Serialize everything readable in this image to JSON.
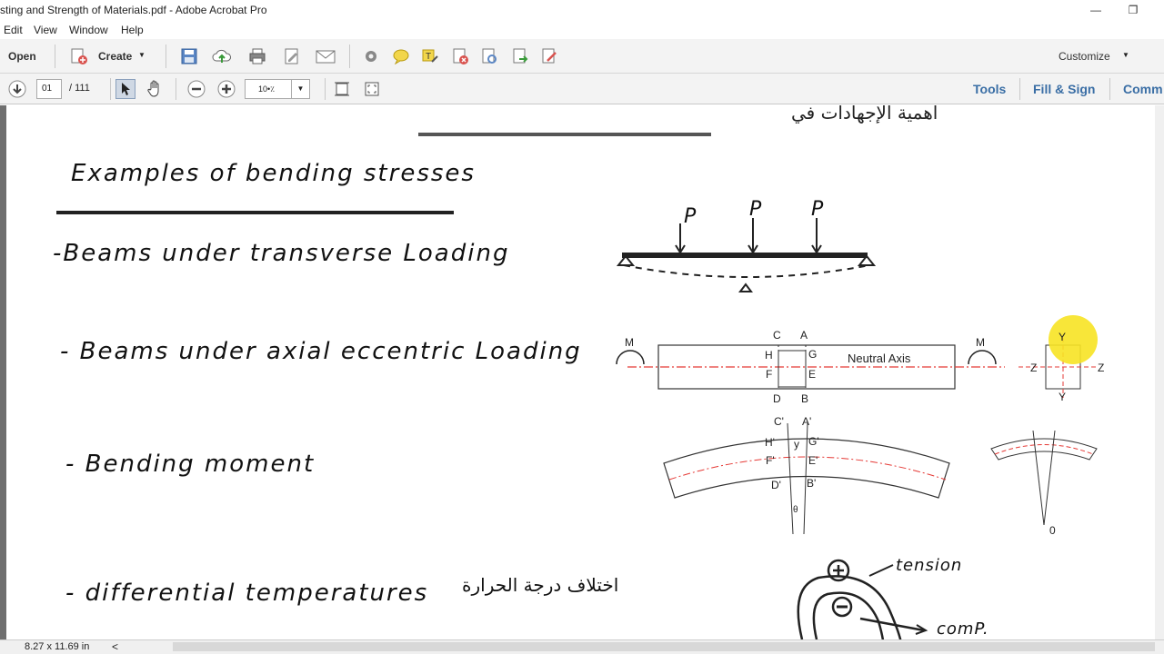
{
  "window": {
    "title": "sting and Strength of Materials.pdf - Adobe Acrobat Pro",
    "minimize": "—",
    "restore": "❐"
  },
  "menu": [
    "Edit",
    "View",
    "Window",
    "Help"
  ],
  "toolbar": {
    "open_label": "Open",
    "create_label": "Create",
    "customize_label": "Customize"
  },
  "nav": {
    "page_value": "01",
    "page_total": "/ 111",
    "zoom_value": "10•٪"
  },
  "right_links": [
    "Tools",
    "Fill & Sign",
    "Comm"
  ],
  "status": {
    "page_size": "8.27 x 11.69 in",
    "scroll_left": "<"
  },
  "doc": {
    "top_arabic": "أهمية الإجهادات في",
    "heading": "Examples of bending stresses",
    "items": [
      "-Beams under transverse Loading",
      "- Beams under axial eccentric Loading",
      "- Bending moment",
      "- differential temperatures",
      "اختلاف درجة الحرارة"
    ],
    "diagram1": {
      "load_labels": [
        "P",
        "P",
        "P"
      ]
    },
    "diagram2": {
      "moment_labels": [
        "M",
        "M"
      ],
      "neutral_axis": "Neutral Axis",
      "points_top": [
        "C",
        "A"
      ],
      "points_mid": [
        "H",
        "G",
        "F",
        "E"
      ],
      "points_bottom": [
        "D",
        "B"
      ],
      "section_labels": [
        "Y",
        "Z",
        "Z",
        "Y"
      ]
    },
    "diagram3": {
      "points": [
        "C'",
        "A'",
        "H'",
        "G'",
        "F'",
        "E'",
        "D'",
        "B'"
      ],
      "center_label": "y",
      "angle_label": "θ",
      "origin_label": "0"
    },
    "diagram4": {
      "tension_label": "tension",
      "comp_label": "comP."
    }
  }
}
